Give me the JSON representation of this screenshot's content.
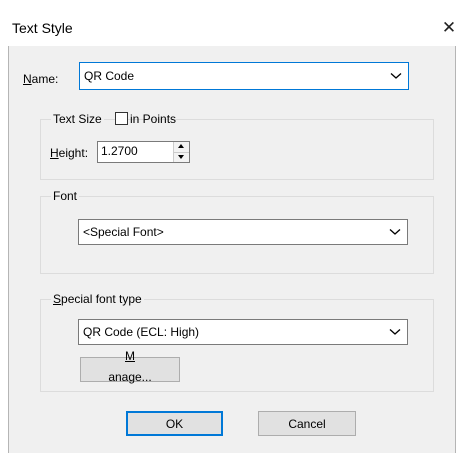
{
  "window": {
    "title": "Text Style",
    "close_icon": "close-icon"
  },
  "name": {
    "label": "Name:",
    "value": "QR Code"
  },
  "text_size": {
    "group_title": "Text Size",
    "in_points_label": "in Points",
    "in_points_checked": false,
    "height_label": "Height:",
    "height_value": "1.2700"
  },
  "font": {
    "group_title": "Font",
    "value": "<Special Font>"
  },
  "special_font": {
    "group_title": "Special font type",
    "value": "QR Code (ECL: High)",
    "manage_label": "Manage..."
  },
  "buttons": {
    "ok_label": "OK",
    "cancel_label": "Cancel"
  },
  "colors": {
    "dialog_background": "#f0f0f0",
    "focus_accent": "#0078d7"
  }
}
